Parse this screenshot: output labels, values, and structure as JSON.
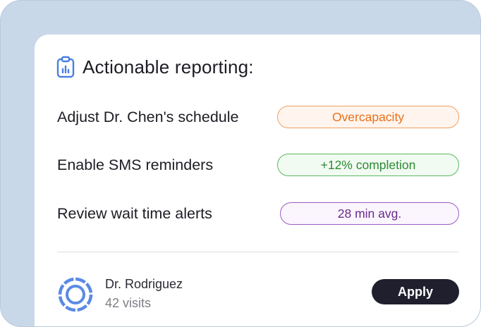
{
  "card": {
    "title": "Actionable reporting:",
    "header_icon": "clipboard-chart-icon",
    "accent": "#4a7ee0"
  },
  "actions": [
    {
      "label": "Adjust Dr. Chen's schedule",
      "badge": "Overcapacity",
      "badge_color": "#e8701a",
      "badge_bg": "#fff5ee",
      "badge_border": "#f0a060"
    },
    {
      "label": "Enable SMS reminders",
      "badge": "+12% completion",
      "badge_color": "#2e8a36",
      "badge_bg": "#f1fbf1",
      "badge_border": "#5cb860"
    },
    {
      "label": "Review wait time alerts",
      "badge": "28 min avg.",
      "badge_color": "#6a2a8a",
      "badge_bg": "#fbf5fe",
      "badge_border": "#9a5cc0"
    }
  ],
  "footer": {
    "name": "Dr. Rodriguez",
    "visits": "42 visits",
    "avatar_icon": "ring-avatar-icon",
    "apply_label": "Apply"
  }
}
